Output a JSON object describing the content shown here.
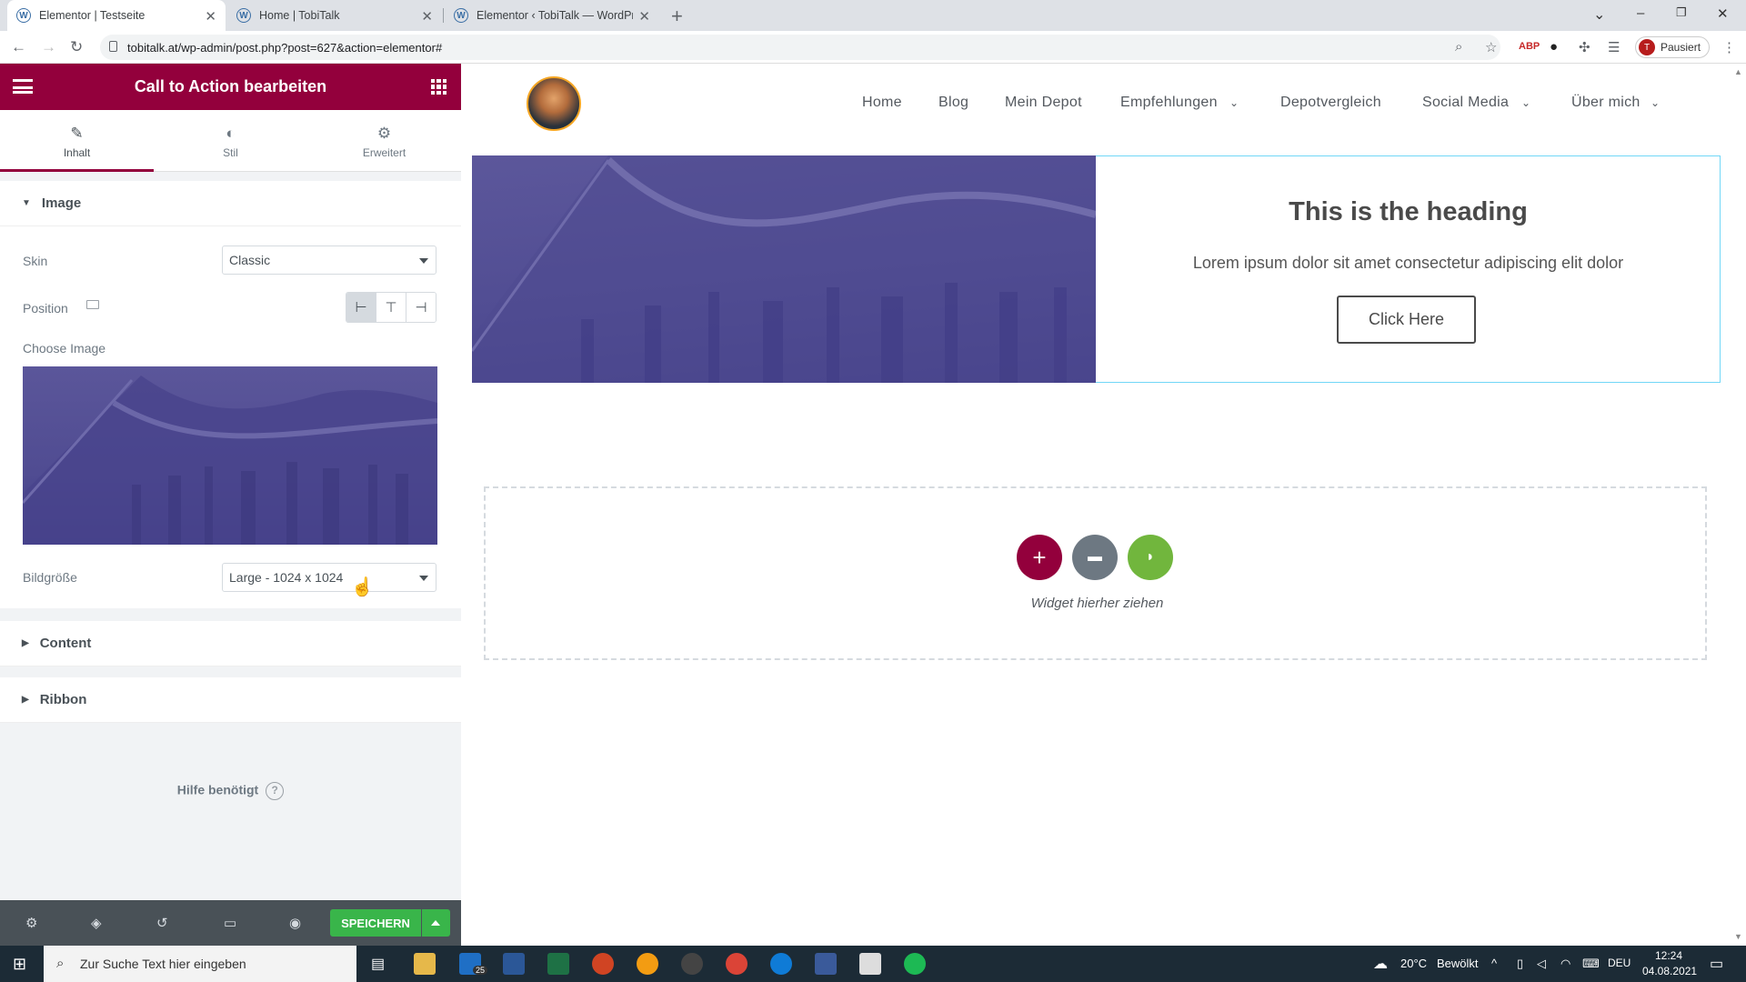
{
  "browser": {
    "tabs": [
      {
        "title": "Elementor | Testseite",
        "active": true
      },
      {
        "title": "Home | TobiTalk",
        "active": false
      },
      {
        "title": "Elementor ‹ TobiTalk — WordPre",
        "active": false
      }
    ],
    "url": "tobitalk.at/wp-admin/post.php?post=627&action=elementor#",
    "profile_initial": "T",
    "profile_label": "Pausiert"
  },
  "panel": {
    "title": "Call to Action bearbeiten",
    "tabs": [
      "Inhalt",
      "Stil",
      "Erweitert"
    ],
    "sections": {
      "image": "Image",
      "content": "Content",
      "ribbon": "Ribbon"
    },
    "controls": {
      "skin_label": "Skin",
      "skin_value": "Classic",
      "position_label": "Position",
      "choose_image_label": "Choose Image",
      "bildgroesse_label": "Bildgröße",
      "bildgroesse_value": "Large - 1024 x 1024"
    },
    "help": "Hilfe benötigt",
    "save_label": "SPEICHERN"
  },
  "site": {
    "nav": [
      "Home",
      "Blog",
      "Mein Depot",
      "Empfehlungen",
      "Depotvergleich",
      "Social Media",
      "Über mich"
    ],
    "cta": {
      "heading": "This is the heading",
      "text": "Lorem ipsum dolor sit amet consectetur adipiscing elit dolor",
      "button": "Click Here"
    },
    "dropzone_text": "Widget hierher ziehen"
  },
  "taskbar": {
    "search_placeholder": "Zur Suche Text hier eingeben",
    "weather": "20°C",
    "weather_desc": "Bewölkt",
    "lang": "DEU",
    "time": "12:24",
    "date": "04.08.2021",
    "mail_badge": "25"
  },
  "colors": {
    "brand": "#93003c",
    "save": "#39b54a",
    "cta_border": "#71d7f7"
  }
}
